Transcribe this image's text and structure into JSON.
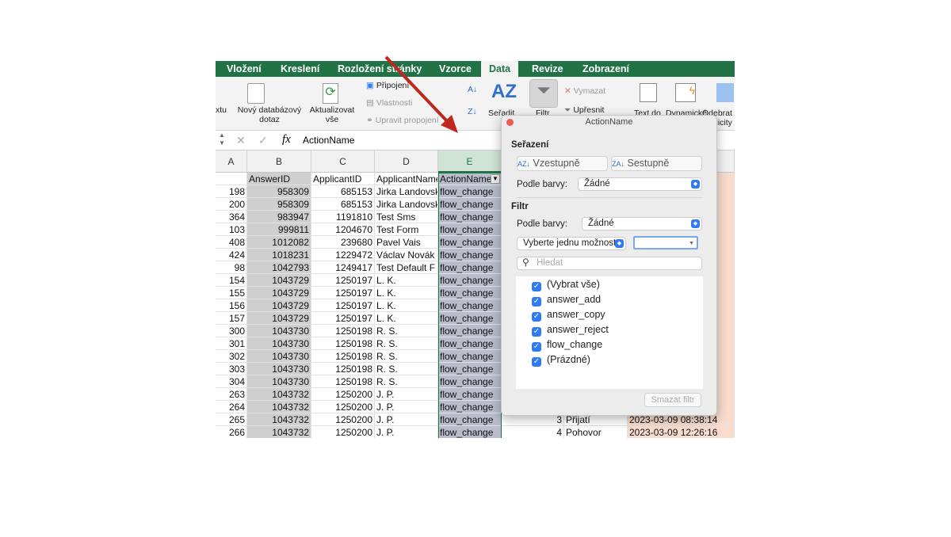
{
  "ribbon_tabs": [
    "Vložení",
    "Kreslení",
    "Rozložení stránky",
    "Vzorce",
    "Data",
    "Revize",
    "Zobrazení"
  ],
  "active_tab": "Data",
  "ribbon": {
    "from_text": "xtu",
    "new_query": "Nový databázový dotaz",
    "refresh_all": "Aktualizovat vše",
    "connections": "Připojení",
    "properties": "Vlastnosti",
    "edit_links": "Upravit propojení",
    "sort": "Seřadit",
    "filter": "Filtr",
    "clear": "Vymazat",
    "advanced": "Upřesnit",
    "text_to_columns": "Text do",
    "dynamic": "Dynamické",
    "remove_dup": "Odebrat duplicity"
  },
  "formula_bar": {
    "fx": "fx",
    "value": "ActionName"
  },
  "columns": [
    "A",
    "B",
    "C",
    "D",
    "E"
  ],
  "headers": [
    "",
    "AnswerID",
    "ApplicantID",
    "ApplicantName",
    "ActionName"
  ],
  "rows": [
    [
      "198",
      "958309",
      "685153",
      "Jirka Landovský",
      "flow_change"
    ],
    [
      "200",
      "958309",
      "685153",
      "Jirka Landovský",
      "flow_change"
    ],
    [
      "364",
      "983947",
      "1191810",
      "Test Sms",
      "flow_change"
    ],
    [
      "103",
      "999811",
      "1204670",
      "Test Form",
      "flow_change"
    ],
    [
      "408",
      "1012082",
      "239680",
      "Pavel Vais",
      "flow_change"
    ],
    [
      "424",
      "1018231",
      "1229472",
      "Václav Novák",
      "flow_change"
    ],
    [
      "98",
      "1042793",
      "1249417",
      "Test Default F",
      "flow_change"
    ],
    [
      "154",
      "1043729",
      "1250197",
      "L. K.",
      "flow_change"
    ],
    [
      "155",
      "1043729",
      "1250197",
      "L. K.",
      "flow_change"
    ],
    [
      "156",
      "1043729",
      "1250197",
      "L. K.",
      "flow_change"
    ],
    [
      "157",
      "1043729",
      "1250197",
      "L. K.",
      "flow_change"
    ],
    [
      "300",
      "1043730",
      "1250198",
      "R. S.",
      "flow_change"
    ],
    [
      "301",
      "1043730",
      "1250198",
      "R. S.",
      "flow_change"
    ],
    [
      "302",
      "1043730",
      "1250198",
      "R. S.",
      "flow_change"
    ],
    [
      "303",
      "1043730",
      "1250198",
      "R. S.",
      "flow_change"
    ],
    [
      "304",
      "1043730",
      "1250198",
      "R. S.",
      "flow_change"
    ],
    [
      "263",
      "1043732",
      "1250200",
      "J. P.",
      "flow_change"
    ],
    [
      "264",
      "1043732",
      "1250200",
      "J. P.",
      "flow_change"
    ],
    [
      "265",
      "1043732",
      "1250200",
      "J. P.",
      "flow_change"
    ],
    [
      "266",
      "1043732",
      "1250200",
      "J. P.",
      "flow_change"
    ]
  ],
  "right_rows": [
    [
      "3",
      "Přijatí",
      "2023-03-09 08:38:14"
    ],
    [
      "4",
      "Pohovor",
      "2023-03-09 12:26:16"
    ]
  ],
  "dialog": {
    "title": "ActionName",
    "sort_heading": "Seřazení",
    "ascending": "Vzestupně",
    "descending": "Sestupně",
    "by_color_label": "Podle barvy:",
    "sort_color": "Žádné",
    "filter_heading": "Filtr",
    "filter_color": "Žádné",
    "choose_option": "Vyberte jednu možnost",
    "search_placeholder": "Hledat",
    "items": [
      {
        "label": "(Vybrat vše)",
        "checked": true
      },
      {
        "label": "answer_add",
        "checked": true
      },
      {
        "label": "answer_copy",
        "checked": true
      },
      {
        "label": "answer_reject",
        "checked": true
      },
      {
        "label": "flow_change",
        "checked": true
      },
      {
        "label": "(Prázdné)",
        "checked": true
      }
    ],
    "clear_filter": "Smazat filtr"
  },
  "colors": {
    "excel_green": "#217346",
    "arrow": "#c0281f",
    "highlight_col": "#f9dccd"
  }
}
